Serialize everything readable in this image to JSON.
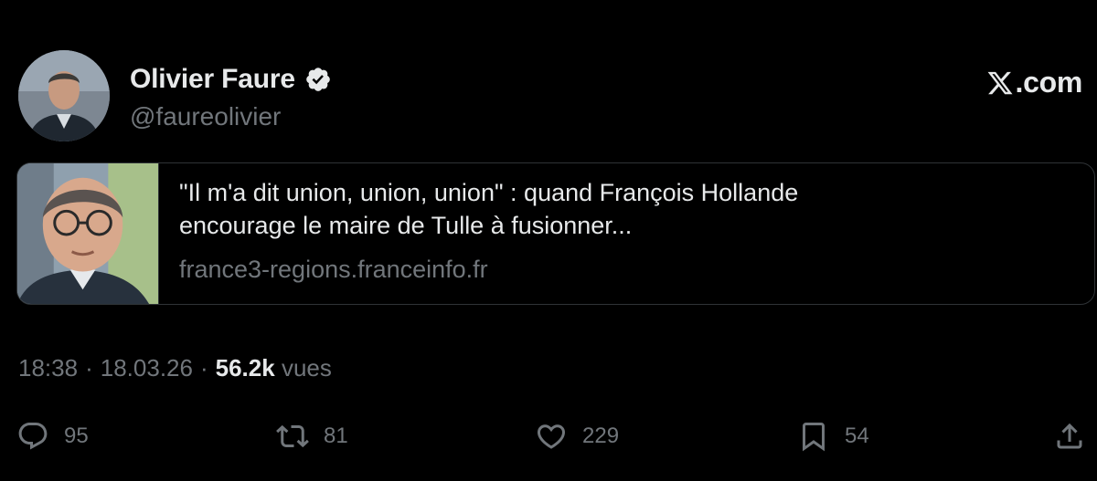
{
  "author": {
    "display_name": "Olivier Faure",
    "handle": "@faureolivier",
    "verified_icon": "verified-badge-icon",
    "avatar": "avatar-photo"
  },
  "brand": {
    "icon": "x-logo-icon",
    "text": ".com"
  },
  "link_card": {
    "title_line1": "\"Il m'a dit union, union, union\" : quand François Hollande",
    "title_line2": "encourage le maire de Tulle à fusionner...",
    "domain": "france3-regions.franceinfo.fr",
    "thumbnail": "article-thumbnail-photo"
  },
  "meta": {
    "time": "18:38",
    "sep1": "·",
    "date": "18.03.26",
    "sep2": "·",
    "views_count": "56.2k",
    "views_label": "vues"
  },
  "actions": {
    "reply": {
      "icon": "reply-icon",
      "count": "95"
    },
    "retweet": {
      "icon": "retweet-icon",
      "count": "81"
    },
    "like": {
      "icon": "heart-icon",
      "count": "229"
    },
    "bookmark": {
      "icon": "bookmark-icon",
      "count": "54"
    },
    "share": {
      "icon": "share-icon"
    }
  },
  "colors": {
    "background": "#000000",
    "primary_text": "#e7e9ea",
    "secondary_text": "#71767b",
    "border": "#2f3336"
  }
}
